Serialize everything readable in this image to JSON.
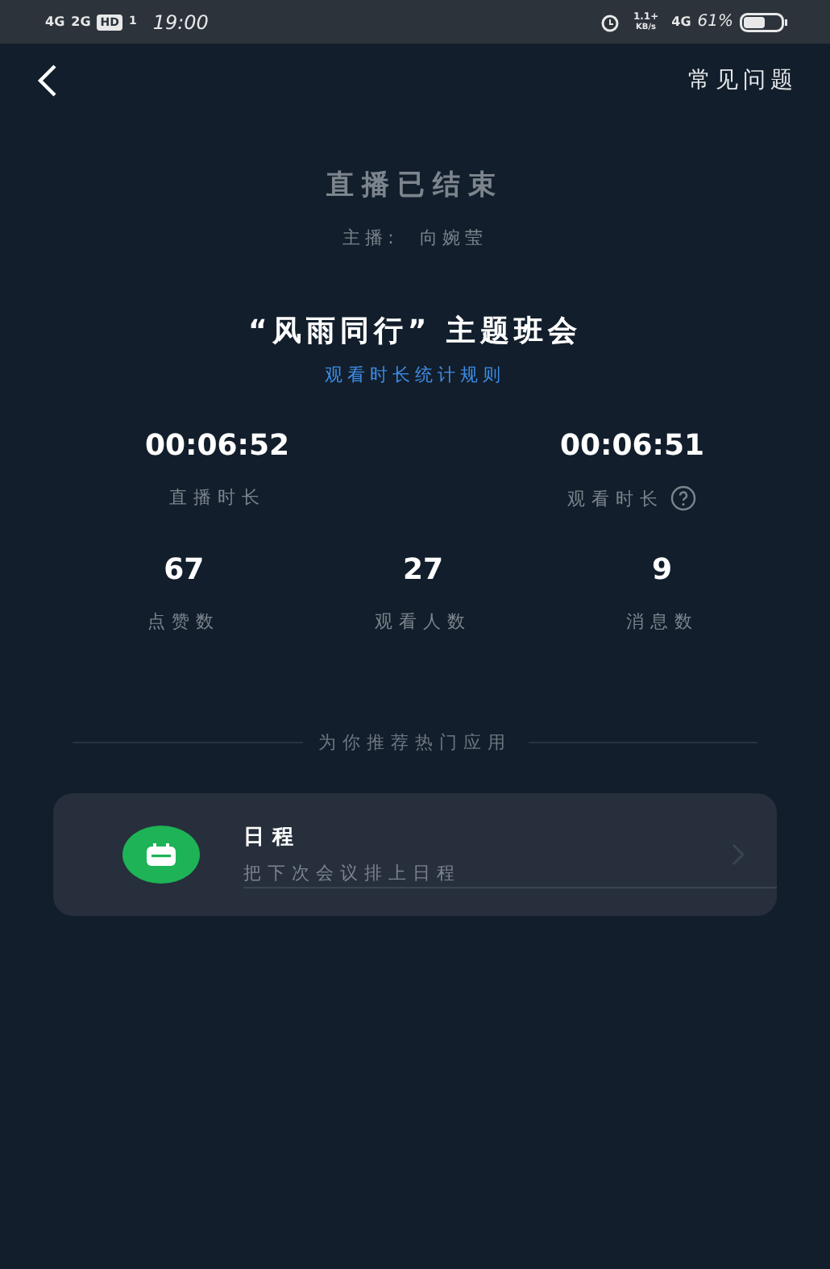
{
  "status_bar": {
    "network_1": "4G",
    "network_2": "2G",
    "hd": "HD",
    "sim": "1",
    "time": "19:00",
    "speed": "1.1+",
    "speed_unit": "KB/s",
    "network_3": "4G",
    "battery": "61%"
  },
  "nav": {
    "faq": "常见问题"
  },
  "header": {
    "status": "直播已结束",
    "host": "主播:  向婉莹"
  },
  "meeting": {
    "title": "“风雨同行” 主题班会",
    "rule_link": "观看时长统计规则"
  },
  "durations": [
    {
      "value": "00:06:52",
      "label": "直播时长",
      "help": false
    },
    {
      "value": "00:06:51",
      "label": "观看时长",
      "help": true
    }
  ],
  "counts": [
    {
      "value": "67",
      "label": "点赞数"
    },
    {
      "value": "27",
      "label": "观看人数"
    },
    {
      "value": "9",
      "label": "消息数"
    }
  ],
  "recommend": {
    "heading": "为你推荐热门应用",
    "apps": [
      {
        "name": "日程",
        "description": "把下次会议排上日程"
      }
    ]
  }
}
